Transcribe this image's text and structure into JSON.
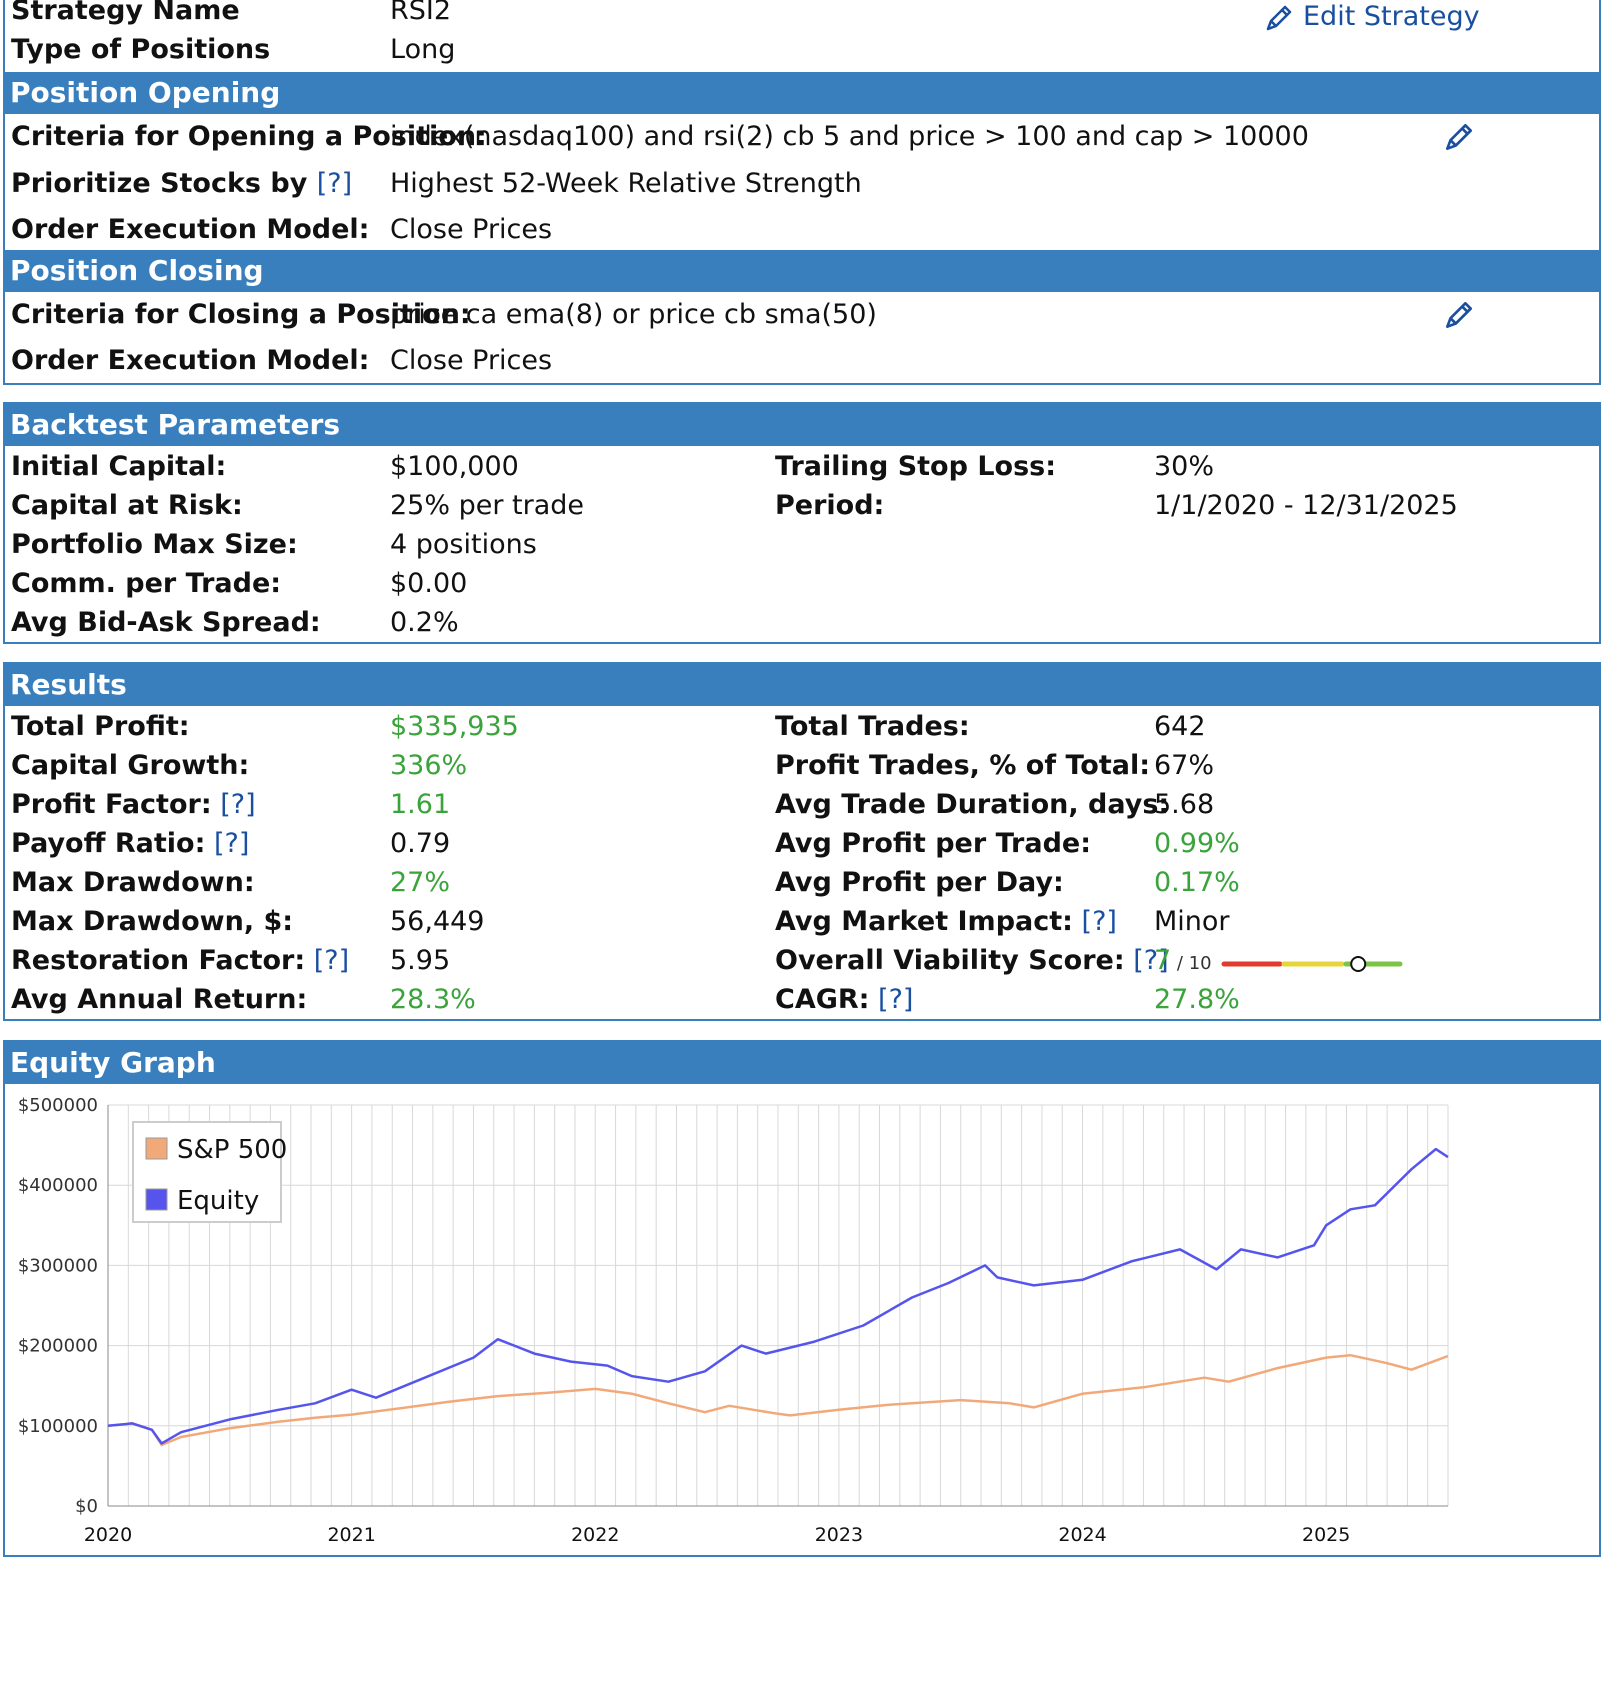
{
  "strategy": {
    "name_label": "Strategy Name",
    "name_value": "RSI2",
    "type_label": "Type of Positions",
    "type_value": "Long",
    "edit_label": "Edit Strategy"
  },
  "opening": {
    "title": "Position Opening",
    "criteria_label": "Criteria for Opening a Position:",
    "criteria_value": "index(nasdaq100) and rsi(2) cb 5 and price > 100 and cap > 10000",
    "prioritize_label": "Prioritize Stocks by",
    "prioritize_help": "[?]",
    "prioritize_value": "Highest 52-Week Relative Strength",
    "execution_label": "Order Execution Model:",
    "execution_value": "Close Prices"
  },
  "closing": {
    "title": "Position Closing",
    "criteria_label": "Criteria for Closing a Position:",
    "criteria_value": "price ca ema(8) or price cb sma(50)",
    "execution_label": "Order Execution Model:",
    "execution_value": "Close Prices"
  },
  "backtest": {
    "title": "Backtest Parameters",
    "left": [
      {
        "label": "Initial Capital:",
        "value": "$100,000"
      },
      {
        "label": "Capital at Risk:",
        "value": "25% per trade"
      },
      {
        "label": "Portfolio Max Size:",
        "value": "4 positions"
      },
      {
        "label": "Comm. per Trade:",
        "value": "$0.00"
      },
      {
        "label": "Avg Bid-Ask Spread:",
        "value": "0.2%"
      }
    ],
    "right": [
      {
        "label": "Trailing Stop Loss:",
        "value": "30%"
      },
      {
        "label": "Period:",
        "value": "1/1/2020 - 12/31/2025"
      }
    ]
  },
  "results": {
    "title": "Results",
    "help": "[?]",
    "left": [
      {
        "label": "Total Profit:",
        "value": "$335,935",
        "green": true,
        "help": false
      },
      {
        "label": "Capital Growth:",
        "value": "336%",
        "green": true,
        "help": false
      },
      {
        "label": "Profit Factor:",
        "value": "1.61",
        "green": true,
        "help": true
      },
      {
        "label": "Payoff Ratio:",
        "value": "0.79",
        "green": false,
        "help": true
      },
      {
        "label": "Max Drawdown:",
        "value": "27%",
        "green": true,
        "help": false
      },
      {
        "label": "Max Drawdown, $:",
        "value": "56,449",
        "green": false,
        "help": false
      },
      {
        "label": "Restoration Factor:",
        "value": "5.95",
        "green": false,
        "help": true
      },
      {
        "label": "Avg Annual Return:",
        "value": "28.3%",
        "green": true,
        "help": false
      }
    ],
    "right": [
      {
        "label": "Total Trades:",
        "value": "642",
        "green": false,
        "help": false
      },
      {
        "label": "Profit Trades, % of Total:",
        "value": "67%",
        "green": false,
        "help": false
      },
      {
        "label": "Avg Trade Duration, days:",
        "value": "5.68",
        "green": false,
        "help": false
      },
      {
        "label": "Avg Profit per Trade:",
        "value": "0.99%",
        "green": true,
        "help": false
      },
      {
        "label": "Avg Profit per Day:",
        "value": "0.17%",
        "green": true,
        "help": false
      },
      {
        "label": "Avg Market Impact:",
        "value": "Minor",
        "green": false,
        "help": true
      },
      {
        "label": "Overall Viability Score:",
        "value": "7",
        "green": true,
        "help": true,
        "suffix": "/ 10",
        "score": 7,
        "max": 10
      },
      {
        "label": "CAGR:",
        "value": "27.8%",
        "green": true,
        "help": true
      }
    ]
  },
  "equity": {
    "title": "Equity Graph"
  },
  "colors": {
    "header": "#3a7fbd",
    "green": "#3aa33a",
    "link": "#1a4fa0",
    "equity": "#5555ee",
    "sp500": "#f2a97a"
  },
  "chart_data": {
    "type": "line",
    "title": "",
    "xlabel": "",
    "ylabel": "",
    "ylim": [
      0,
      500000
    ],
    "yticks": [
      "$500000",
      "$400000",
      "$300000",
      "$200000",
      "$100000",
      "$0"
    ],
    "xticks": [
      "2020",
      "2021",
      "2022",
      "2023",
      "2024",
      "2025"
    ],
    "legend": "top-left",
    "grid": true,
    "series": [
      {
        "name": "S&P 500",
        "color": "#f2a97a",
        "x": [
          2020.0,
          2020.1,
          2020.18,
          2020.22,
          2020.3,
          2020.5,
          2020.7,
          2020.85,
          2021.0,
          2021.2,
          2021.4,
          2021.6,
          2021.8,
          2022.0,
          2022.15,
          2022.3,
          2022.45,
          2022.55,
          2022.75,
          2022.8,
          2023.0,
          2023.2,
          2023.5,
          2023.7,
          2023.8,
          2024.0,
          2024.25,
          2024.5,
          2024.6,
          2024.8,
          2025.0,
          2025.1,
          2025.25,
          2025.35,
          2025.5
        ],
        "values": [
          100000,
          103000,
          95000,
          76000,
          86000,
          97000,
          105000,
          110000,
          114000,
          122000,
          130000,
          137000,
          141000,
          146000,
          140000,
          128000,
          117000,
          125000,
          115000,
          113000,
          120000,
          126000,
          132000,
          128000,
          123000,
          140000,
          148000,
          160000,
          155000,
          172000,
          185000,
          188000,
          178000,
          170000,
          187000
        ]
      },
      {
        "name": "Equity",
        "color": "#5555ee",
        "x": [
          2020.0,
          2020.1,
          2020.18,
          2020.22,
          2020.3,
          2020.5,
          2020.7,
          2020.85,
          2021.0,
          2021.1,
          2021.3,
          2021.5,
          2021.6,
          2021.75,
          2021.9,
          2022.05,
          2022.15,
          2022.3,
          2022.45,
          2022.6,
          2022.7,
          2022.9,
          2023.1,
          2023.3,
          2023.45,
          2023.6,
          2023.65,
          2023.8,
          2024.0,
          2024.2,
          2024.4,
          2024.55,
          2024.65,
          2024.8,
          2024.95,
          2025.0,
          2025.1,
          2025.2,
          2025.35,
          2025.45,
          2025.5
        ],
        "values": [
          100000,
          103000,
          95000,
          78000,
          92000,
          108000,
          120000,
          128000,
          145000,
          135000,
          160000,
          185000,
          208000,
          190000,
          180000,
          175000,
          162000,
          155000,
          168000,
          200000,
          190000,
          205000,
          225000,
          260000,
          278000,
          300000,
          285000,
          275000,
          282000,
          305000,
          320000,
          295000,
          320000,
          310000,
          325000,
          350000,
          370000,
          375000,
          420000,
          445000,
          435000
        ]
      }
    ]
  }
}
